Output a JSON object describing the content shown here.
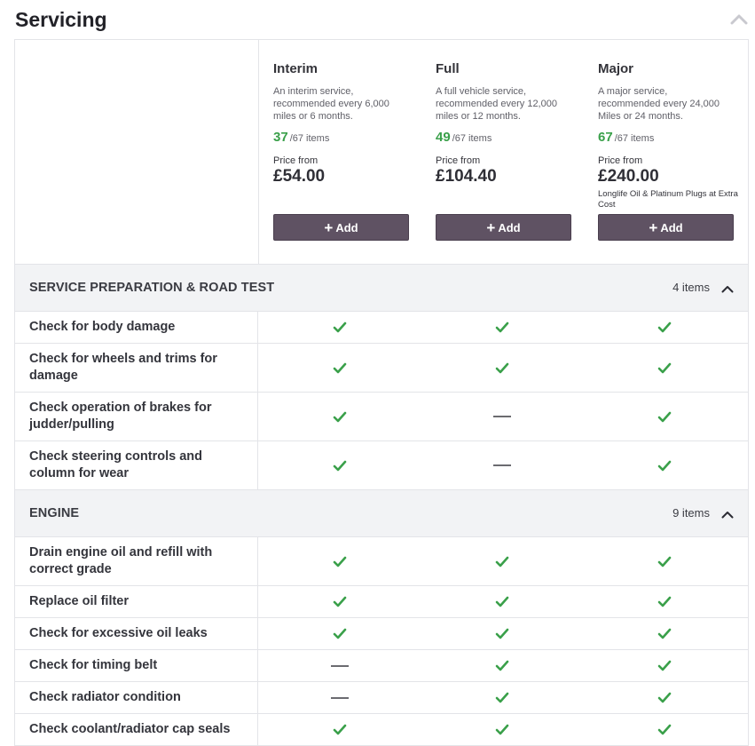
{
  "page": {
    "title": "Servicing"
  },
  "plans": [
    {
      "name": "Interim",
      "description": "An interim service, recommended every 6,000 miles or 6 months.",
      "count": "37",
      "total": "/67 items",
      "price_label": "Price from",
      "price": "£54.00",
      "note": "",
      "add_label": "Add"
    },
    {
      "name": "Full",
      "description": "A full vehicle service, recommended every 12,000 miles or 12 months.",
      "count": "49",
      "total": "/67 items",
      "price_label": "Price from",
      "price": "£104.40",
      "note": "",
      "add_label": "Add"
    },
    {
      "name": "Major",
      "description": "A major service, recommended every 24,000 Miles or 24 months.",
      "count": "67",
      "total": "/67 items",
      "price_label": "Price from",
      "price": "£240.00",
      "note": "Longlife Oil & Platinum Plugs at Extra Cost",
      "add_label": "Add"
    }
  ],
  "sections": [
    {
      "title": "SERVICE PREPARATION & ROAD TEST",
      "count": "4 items",
      "rows": [
        {
          "label": "Check for body damage",
          "values": [
            true,
            true,
            true
          ]
        },
        {
          "label": "Check for wheels and trims for damage",
          "values": [
            true,
            true,
            true
          ]
        },
        {
          "label": "Check operation of brakes for judder/pulling",
          "values": [
            true,
            false,
            true
          ]
        },
        {
          "label": "Check steering controls and column for wear",
          "values": [
            true,
            false,
            true
          ]
        }
      ]
    },
    {
      "title": "ENGINE",
      "count": "9 items",
      "rows": [
        {
          "label": "Drain engine oil and refill with correct grade",
          "values": [
            true,
            true,
            true
          ]
        },
        {
          "label": "Replace oil filter",
          "values": [
            true,
            true,
            true
          ]
        },
        {
          "label": "Check for excessive oil leaks",
          "values": [
            true,
            true,
            true
          ]
        },
        {
          "label": "Check for timing belt",
          "values": [
            false,
            true,
            true
          ]
        },
        {
          "label": "Check radiator condition",
          "values": [
            false,
            true,
            true
          ]
        },
        {
          "label": "Check coolant/radiator cap seals",
          "values": [
            true,
            true,
            true
          ]
        }
      ]
    }
  ],
  "colors": {
    "check": "#3aa04a",
    "dash": "#3a3a40",
    "button": "#5f5263"
  },
  "icons": {
    "included": "check-icon",
    "excluded": "dash-icon",
    "collapse": "chevron-up-icon",
    "add": "plus-icon"
  }
}
